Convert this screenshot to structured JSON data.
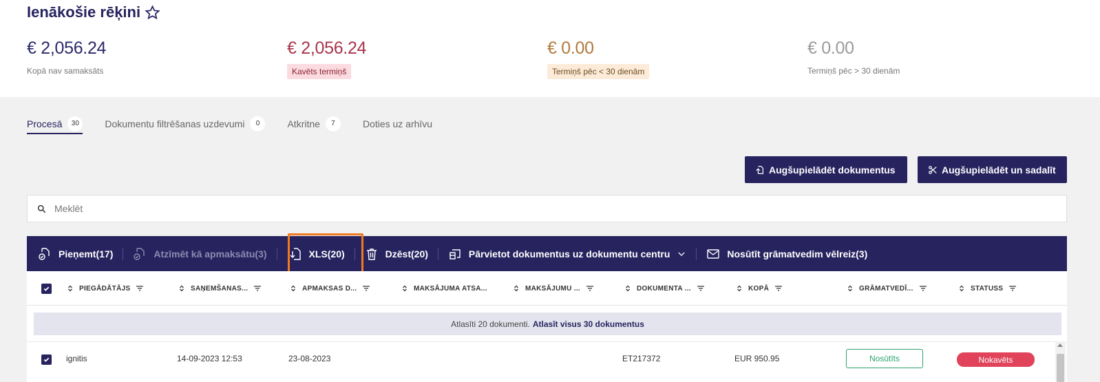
{
  "header": {
    "title": "Ienākošie rēķini"
  },
  "stats": [
    {
      "amount": "€ 2,056.24",
      "label": "Kopā nav samaksāts"
    },
    {
      "amount": "€ 2,056.24",
      "label": "Kavēts termiņš"
    },
    {
      "amount": "€ 0.00",
      "label": "Termiņš pēc < 30 dienām"
    },
    {
      "amount": "€ 0.00",
      "label": "Termiņš pēc > 30 dienām"
    }
  ],
  "tabs": [
    {
      "label": "Procesā",
      "count": "30"
    },
    {
      "label": "Dokumentu filtrēšanas uzdevumi",
      "count": "0"
    },
    {
      "label": "Atkritne",
      "count": "7"
    },
    {
      "label": "Doties uz arhīvu"
    }
  ],
  "buttons": {
    "upload": "Augšupielādēt dokumentus",
    "upload_split": "Augšupielādēt un sadalīt"
  },
  "search": {
    "placeholder": "Meklēt"
  },
  "actions": {
    "accept": "Pieņemt(17)",
    "mark_paid": "Atzīmēt kā apmaksātu(3)",
    "xls": "XLS(20)",
    "delete": "Dzēst(20)",
    "move": "Pārvietot dokumentus uz dokumentu centru",
    "resend": "Nosūtīt grāmatvedim vēlreiz(3)"
  },
  "table": {
    "columns": [
      "PIEGĀDĀTĀJS",
      "SAŅEMŠANAS...",
      "APMAKSAS D...",
      "MAKSĀJUMA ATSA...",
      "MAKSĀJUMU ...",
      "DOKUMENTA ...",
      "KOPĀ",
      "GRĀMATVEDĪ...",
      "STATUSS"
    ],
    "selection": {
      "text": "Atlasīti 20 dokumenti.",
      "link": "Atlasīt visus 30 dokumentus"
    },
    "rows": [
      {
        "supplier": "ignitis",
        "received": "14-09-2023 12:53",
        "due": "23-08-2023",
        "doc": "ET217372",
        "total": "EUR 950.95",
        "accountant": "Nosūtīts",
        "status": "Nokavēts"
      }
    ]
  },
  "colors": {
    "brand": "#27235f",
    "highlight": "#f07a22",
    "late": "#e0435a",
    "sent": "#2aa36b"
  }
}
